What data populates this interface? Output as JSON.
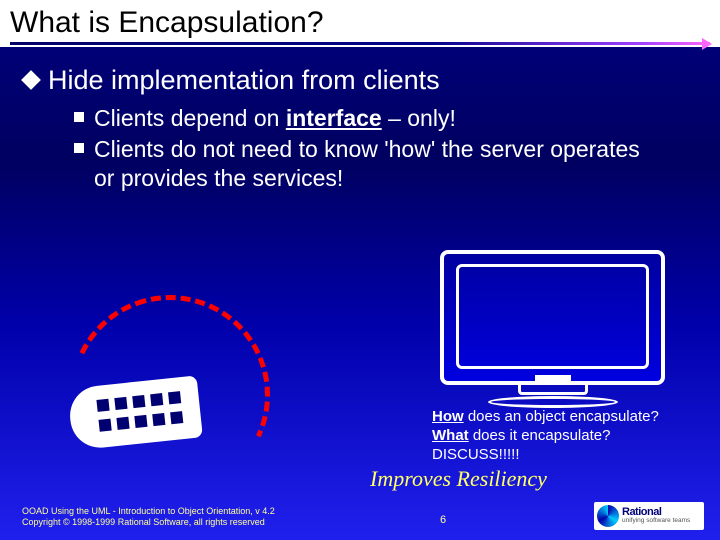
{
  "title": "What is Encapsulation?",
  "bullets": {
    "main": "Hide implementation from clients",
    "sub1_pre": "Clients depend on ",
    "sub1_word": "interface",
    "sub1_post": " – only!",
    "sub2": "Clients do not need to know 'how' the server operates or provides the services!"
  },
  "questions": {
    "how": "How",
    "how_rest": " does an object encapsulate?",
    "what": "What",
    "what_rest": " does it encapsulate?",
    "discuss": "DISCUSS!!!!!"
  },
  "resiliency": "Improves Resiliency",
  "footer": {
    "line1": "OOAD Using the UML - Introduction to Object Orientation, v 4.2",
    "line2": "Copyright © 1998-1999 Rational Software, all rights reserved",
    "page": "6"
  },
  "logo": {
    "main": "Rational",
    "sub": "unifying software teams"
  }
}
